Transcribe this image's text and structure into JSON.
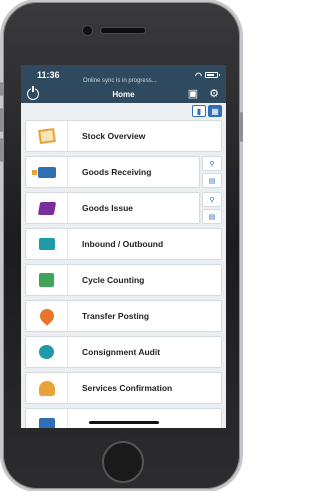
{
  "status_bar": {
    "time": "11:36",
    "sync_text": "Online sync is in progress..."
  },
  "header": {
    "title": "Home"
  },
  "menu": {
    "items": [
      {
        "label": "Stock Overview",
        "icon": "box-icon",
        "has_actions": false
      },
      {
        "label": "Goods Receiving",
        "icon": "truck-icon",
        "has_actions": true
      },
      {
        "label": "Goods Issue",
        "icon": "cart-icon",
        "has_actions": true
      },
      {
        "label": "Inbound / Outbound",
        "icon": "exchange-icon",
        "has_actions": false
      },
      {
        "label": "Cycle Counting",
        "icon": "cube-icon",
        "has_actions": false
      },
      {
        "label": "Transfer Posting",
        "icon": "transfer-icon",
        "has_actions": false
      },
      {
        "label": "Consignment Audit",
        "icon": "audit-icon",
        "has_actions": false
      },
      {
        "label": "Services Confirmation",
        "icon": "service-icon",
        "has_actions": false
      }
    ]
  },
  "colors": {
    "header_bg": "#2f4a5e",
    "accent": "#2f6fb5",
    "background": "#eceff1"
  }
}
